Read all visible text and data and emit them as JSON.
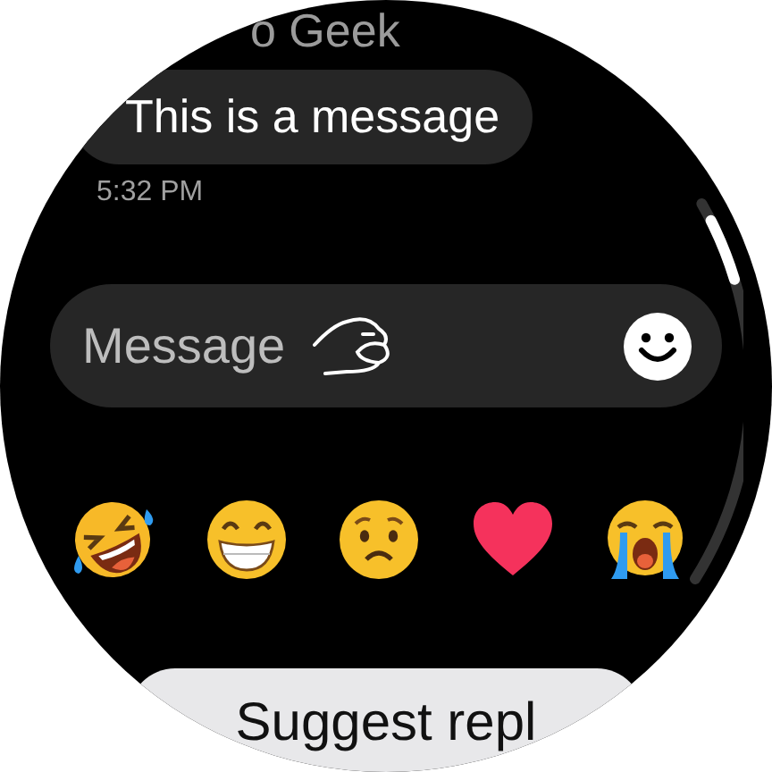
{
  "conversation": {
    "sender": "o Geek",
    "message": "This is a message",
    "time": "5:32 PM"
  },
  "input": {
    "placeholder": "Message"
  },
  "emoji_replies": [
    {
      "kind": "rofl"
    },
    {
      "kind": "grin"
    },
    {
      "kind": "worried"
    },
    {
      "kind": "heart"
    },
    {
      "kind": "sob"
    }
  ],
  "suggest_button": {
    "label": "Suggest repl"
  }
}
